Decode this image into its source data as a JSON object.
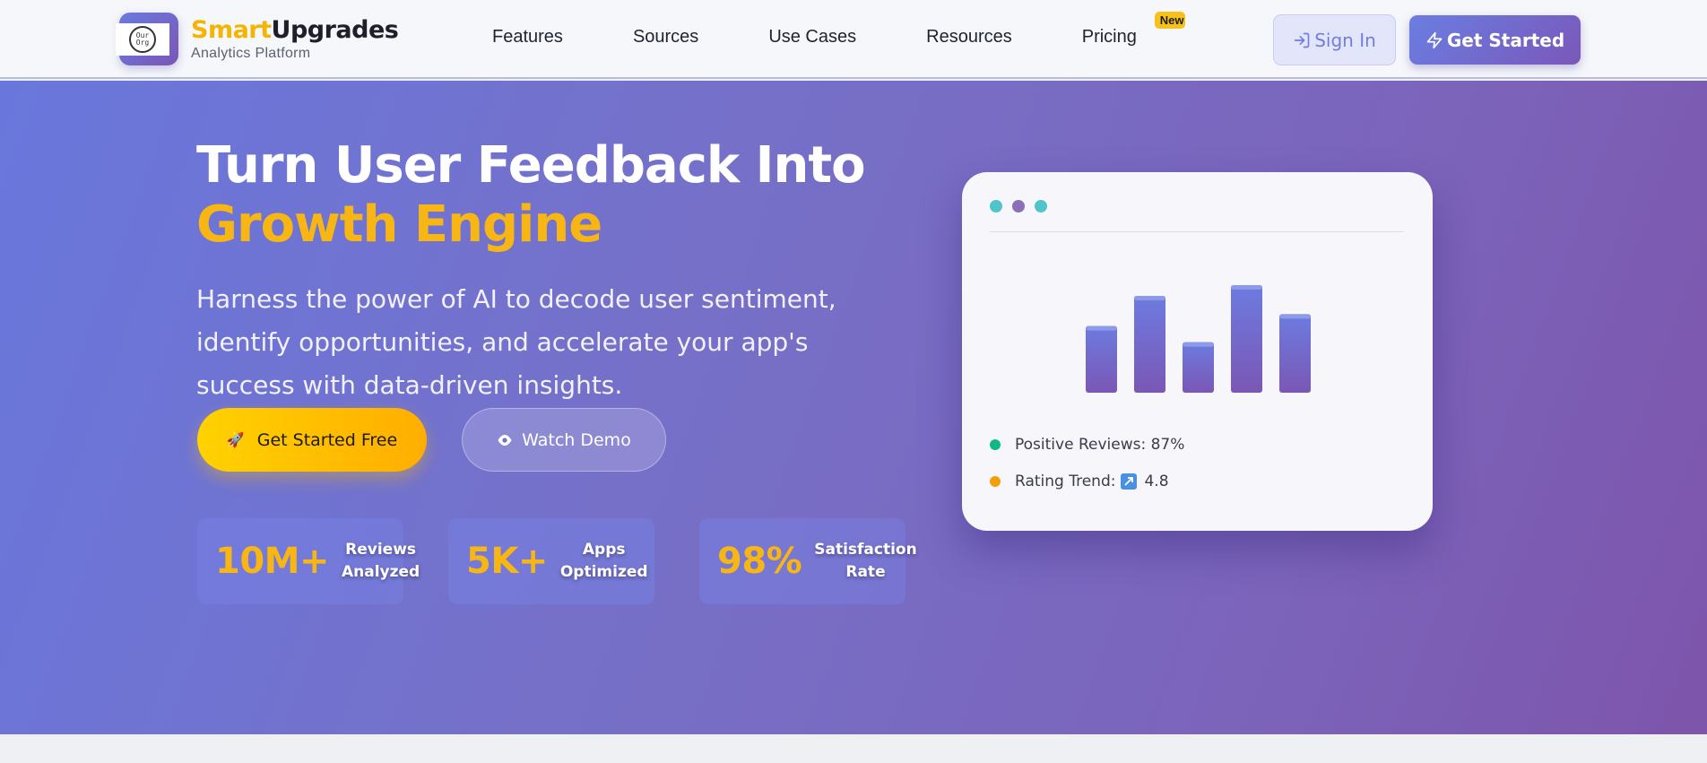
{
  "header": {
    "brand": {
      "name_part1": "Smart",
      "name_part2": "Upgrades",
      "tagline": "Analytics Platform",
      "logo_text": "Our\nOrg"
    },
    "nav": [
      {
        "label": "Features"
      },
      {
        "label": "Sources"
      },
      {
        "label": "Use Cases"
      },
      {
        "label": "Resources"
      },
      {
        "label": "Pricing",
        "badge": "New"
      }
    ],
    "signin_label": "Sign In",
    "get_started_label": "Get Started"
  },
  "hero": {
    "headline_line1": "Turn User Feedback Into",
    "headline_line2": "Growth Engine",
    "subheadline": "Harness the power of AI to decode user sentiment, identify opportunities, and accelerate your app's success with data-driven insights.",
    "cta_primary": {
      "icon": "rocket-icon",
      "label": "Get Started Free"
    },
    "cta_secondary": {
      "icon": "eye-icon",
      "label": "Watch Demo"
    },
    "stats": [
      {
        "value": "10M+",
        "label": "Reviews\nAnalyzed"
      },
      {
        "value": "5K+",
        "label": "Apps\nOptimized"
      },
      {
        "value": "98%",
        "label": "Satisfaction\nRate"
      }
    ]
  },
  "mock_card": {
    "window_dots": [
      "#4fc4c9",
      "#8b6fb8",
      "#4fc4c9"
    ],
    "chart_levels": [
      0.62,
      0.9,
      0.47,
      1.0,
      0.73
    ],
    "positive_reviews": {
      "label": "Positive Reviews: 87%",
      "color": "#10b981"
    },
    "rating_trend": {
      "label": "Rating Trend:",
      "icon": "trend-up-icon",
      "value": "4.8",
      "color": "#f59e0b"
    }
  },
  "colors": {
    "accent_yellow": "#f8b615",
    "brand_purple": "#7b55b6",
    "hero_gradient_start": "#6977dc",
    "hero_gradient_end": "#7d55ab"
  }
}
